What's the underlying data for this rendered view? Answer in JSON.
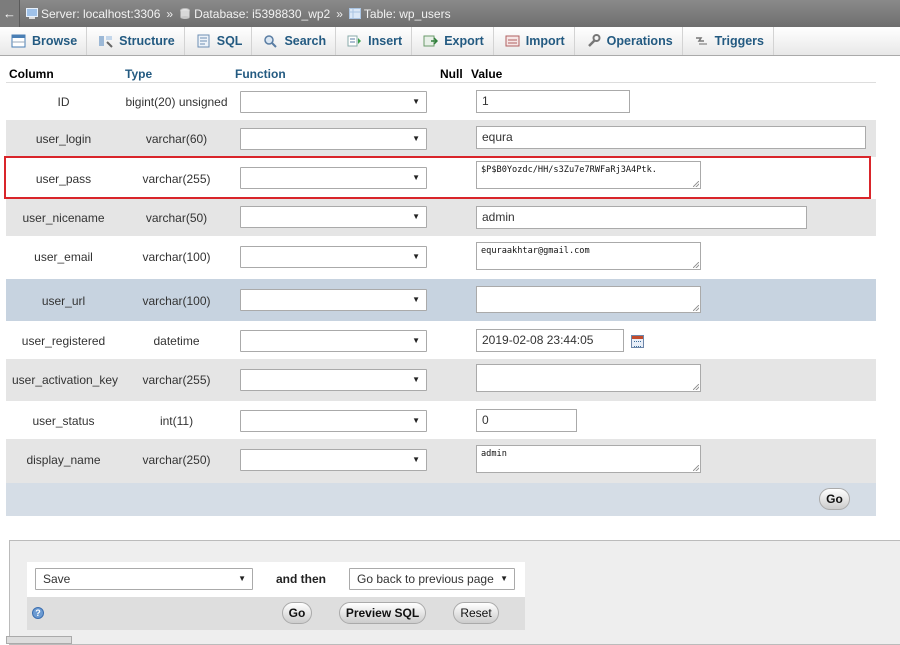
{
  "breadcrumb": {
    "back": "←",
    "server": "Server: localhost:3306",
    "database": "Database: i5398830_wp2",
    "table": "Table: wp_users",
    "separator": "»"
  },
  "tabs": [
    {
      "label": "Browse",
      "icon": "browse-icon"
    },
    {
      "label": "Structure",
      "icon": "structure-icon"
    },
    {
      "label": "SQL",
      "icon": "sql-icon"
    },
    {
      "label": "Search",
      "icon": "search-icon"
    },
    {
      "label": "Insert",
      "icon": "insert-icon"
    },
    {
      "label": "Export",
      "icon": "export-icon"
    },
    {
      "label": "Import",
      "icon": "import-icon"
    },
    {
      "label": "Operations",
      "icon": "wrench-icon"
    },
    {
      "label": "Triggers",
      "icon": "triggers-icon"
    }
  ],
  "headers": {
    "column": "Column",
    "type": "Type",
    "function": "Function",
    "null": "Null",
    "value": "Value"
  },
  "rows": [
    {
      "column": "ID",
      "type": "bigint(20) unsigned",
      "value": "1"
    },
    {
      "column": "user_login",
      "type": "varchar(60)",
      "value": "equra"
    },
    {
      "column": "user_pass",
      "type": "varchar(255)",
      "value": "$P$B0Yozdc/HH/s3Zu7e7RWFaRj3A4Ptk."
    },
    {
      "column": "user_nicename",
      "type": "varchar(50)",
      "value": "admin"
    },
    {
      "column": "user_email",
      "type": "varchar(100)",
      "value": "equraakhtar@gmail.com"
    },
    {
      "column": "user_url",
      "type": "varchar(100)",
      "value": ""
    },
    {
      "column": "user_registered",
      "type": "datetime",
      "value": "2019-02-08 23:44:05"
    },
    {
      "column": "user_activation_key",
      "type": "varchar(255)",
      "value": ""
    },
    {
      "column": "user_status",
      "type": "int(11)",
      "value": "0"
    },
    {
      "column": "display_name",
      "type": "varchar(250)",
      "value": "admin"
    }
  ],
  "go_label": "Go",
  "footer": {
    "save_option": "Save",
    "and_then": "and then",
    "after_option": "Go back to previous page",
    "go": "Go",
    "preview_sql": "Preview SQL",
    "reset": "Reset",
    "help_icon": "?"
  },
  "colors": {
    "highlight_border": "#d9252a",
    "link": "#235a81"
  }
}
